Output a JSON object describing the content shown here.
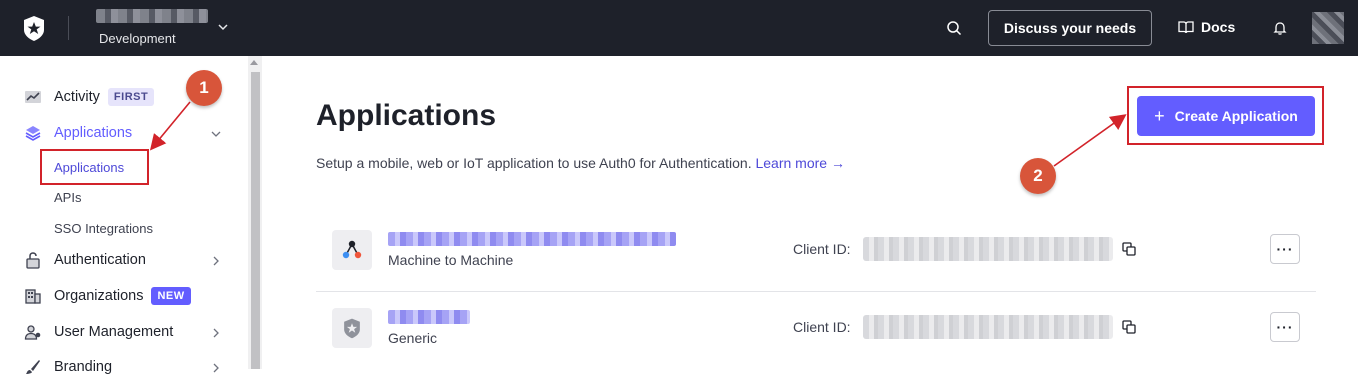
{
  "topbar": {
    "tenant_env": "Development",
    "discuss_label": "Discuss your needs",
    "docs_label": "Docs"
  },
  "sidebar": {
    "activity": {
      "label": "Activity",
      "badge": "FIRST"
    },
    "applications": {
      "label": "Applications"
    },
    "sub_items": [
      "Applications",
      "APIs",
      "SSO Integrations"
    ],
    "authentication": {
      "label": "Authentication"
    },
    "organizations": {
      "label": "Organizations",
      "badge": "NEW"
    },
    "user_management": {
      "label": "User Management"
    },
    "branding": {
      "label": "Branding"
    }
  },
  "main": {
    "title": "Applications",
    "description": "Setup a mobile, web or IoT application to use Auth0 for Authentication.",
    "learn_more": "Learn more →",
    "create_button": "Create Application",
    "apps": [
      {
        "type": "Machine to Machine",
        "client_id_label": "Client ID:"
      },
      {
        "type": "Generic",
        "client_id_label": "Client ID:"
      }
    ]
  },
  "annotations": {
    "step1": "1",
    "step2": "2"
  },
  "colors": {
    "accent": "#635dff",
    "topbar": "#1e212a",
    "annotation": "#d2232a"
  }
}
